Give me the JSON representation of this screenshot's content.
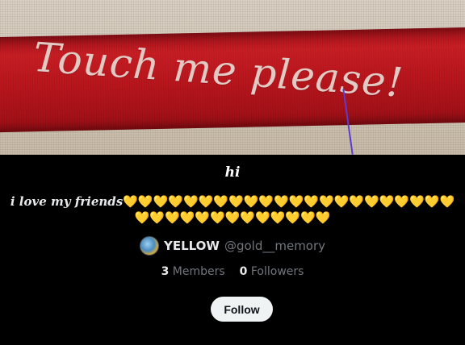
{
  "banner": {
    "text": "Touch me please!"
  },
  "list": {
    "name": "hi",
    "description_script": "i love my friends",
    "description_hearts": "💛💛💛💛💛💛💛💛💛💛💛💛💛💛💛💛💛💛💛💛💛💛💛💛💛💛💛💛💛💛💛💛💛💛💛",
    "owner_name": "YELLOW",
    "owner_handle": "@gold__memory",
    "members_count": "3",
    "members_label": "Members",
    "followers_count": "0",
    "followers_label": "Followers",
    "follow_label": "Follow"
  }
}
